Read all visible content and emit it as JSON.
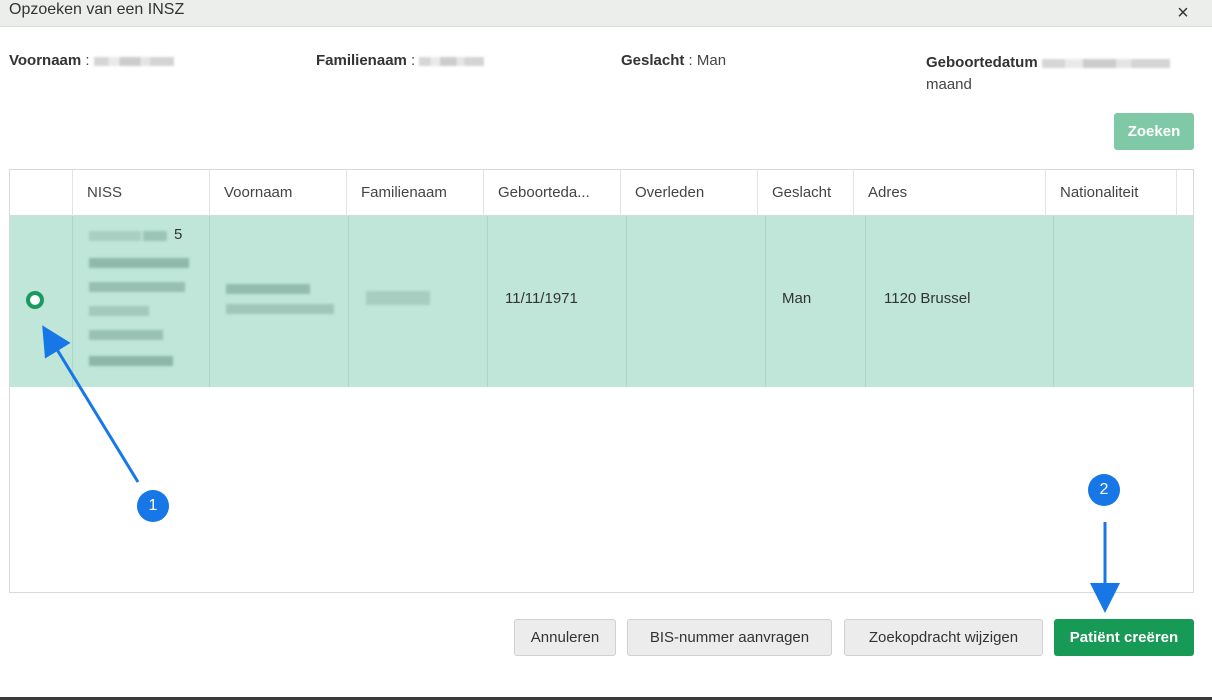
{
  "dialog": {
    "title": "Opzoeken van een INSZ",
    "close_glyph": "×"
  },
  "criteria": {
    "voornaam_label": "Voornaam",
    "familienaam_label": "Familienaam",
    "geslacht_label": "Geslacht",
    "geslacht_value": "Man",
    "geboortedatum_label": "Geboortedatum",
    "geboortedatum_tail": "maand",
    "separator": " : "
  },
  "buttons": {
    "zoeken": "Zoeken",
    "annuleren": "Annuleren",
    "bis": "BIS-nummer aanvragen",
    "wijzigen": "Zoekopdracht wijzigen",
    "creeren": "Patiënt creëren"
  },
  "table": {
    "columns": [
      "",
      "NISS",
      "Voornaam",
      "Familienaam",
      "Geboorteda...",
      "Overleden",
      "Geslacht",
      "Adres",
      "Nationaliteit"
    ],
    "rows": [
      {
        "selected": true,
        "niss_suffix": "5",
        "geboortedatum": "11/11/1971",
        "overleden": "",
        "geslacht": "Man",
        "adres": "1120 Brussel",
        "nationaliteit": ""
      }
    ]
  },
  "annotations": {
    "badge1": "1",
    "badge2": "2",
    "color": "#1777e6"
  },
  "colors": {
    "accent_green": "#179a55",
    "zoeken_green": "#7fc9a6",
    "row_selected": "#bfe6d8"
  }
}
